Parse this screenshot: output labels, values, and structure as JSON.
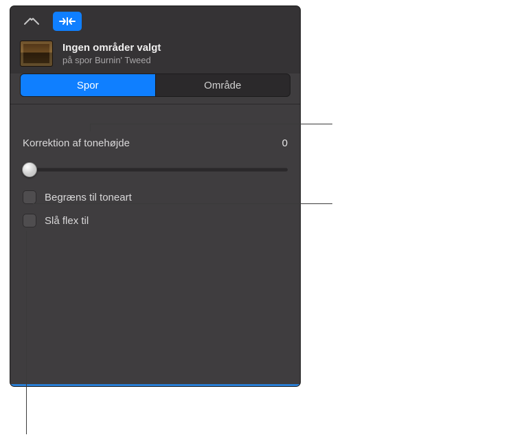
{
  "header": {
    "title": "Ingen områder valgt",
    "subtitle": "på spor Burnin' Tweed"
  },
  "segmented": {
    "track_label": "Spor",
    "region_label": "Område"
  },
  "pitch": {
    "label": "Korrektion af tonehøjde",
    "value": "0"
  },
  "checkboxes": {
    "limit_key_label": "Begræns til toneart",
    "enable_flex_label": "Slå flex til"
  }
}
